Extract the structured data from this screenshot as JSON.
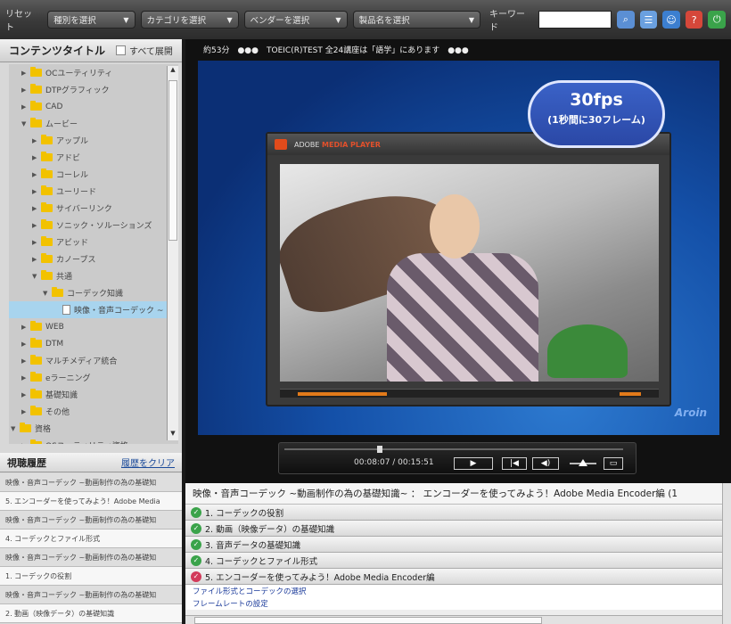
{
  "toolbar": {
    "reset": "リセット",
    "selects": [
      {
        "label": "種別を選択",
        "w": 100
      },
      {
        "label": "カテゴリを選択",
        "w": 118
      },
      {
        "label": "ベンダーを選択",
        "w": 118
      },
      {
        "label": "製品名を選択",
        "w": 148
      }
    ],
    "keyword_label": "キーワード",
    "keyword_value": ""
  },
  "left": {
    "title": "コンテンツタイトル",
    "expand_all": "すべて展開",
    "tree": [
      {
        "label": "OCユーティリティ",
        "indent": 0,
        "type": "folder",
        "tri": "▶"
      },
      {
        "label": "DTPグラフィック",
        "indent": 0,
        "type": "folder",
        "tri": "▶"
      },
      {
        "label": "CAD",
        "indent": 0,
        "type": "folder",
        "tri": "▶"
      },
      {
        "label": "ムービー",
        "indent": 0,
        "type": "folder",
        "tri": "▼"
      },
      {
        "label": "アップル",
        "indent": 1,
        "type": "folder",
        "tri": "▶"
      },
      {
        "label": "アドビ",
        "indent": 1,
        "type": "folder",
        "tri": "▶"
      },
      {
        "label": "コーレル",
        "indent": 1,
        "type": "folder",
        "tri": "▶"
      },
      {
        "label": "ユーリード",
        "indent": 1,
        "type": "folder",
        "tri": "▶"
      },
      {
        "label": "サイバーリンク",
        "indent": 1,
        "type": "folder",
        "tri": "▶"
      },
      {
        "label": "ソニック・ソルーションズ",
        "indent": 1,
        "type": "folder",
        "tri": "▶"
      },
      {
        "label": "アビッド",
        "indent": 1,
        "type": "folder",
        "tri": "▶"
      },
      {
        "label": "カノープス",
        "indent": 1,
        "type": "folder",
        "tri": "▶"
      },
      {
        "label": "共通",
        "indent": 1,
        "type": "folder",
        "tri": "▼"
      },
      {
        "label": "コーデック知識",
        "indent": 2,
        "type": "folder",
        "tri": "▼"
      },
      {
        "label": "映像・音声コーデック ~",
        "indent": 3,
        "type": "doc",
        "tri": "",
        "selected": true
      },
      {
        "label": "WEB",
        "indent": 0,
        "type": "folder",
        "tri": "▶"
      },
      {
        "label": "DTM",
        "indent": 0,
        "type": "folder",
        "tri": "▶"
      },
      {
        "label": "マルチメディア統合",
        "indent": 0,
        "type": "folder",
        "tri": "▶"
      },
      {
        "label": "eラーニング",
        "indent": 0,
        "type": "folder",
        "tri": "▶"
      },
      {
        "label": "基礎知識",
        "indent": 0,
        "type": "folder",
        "tri": "▶"
      },
      {
        "label": "その他",
        "indent": 0,
        "type": "folder",
        "tri": "▶"
      },
      {
        "label": "資格",
        "indent": -1,
        "type": "folder",
        "tri": "▼"
      },
      {
        "label": "OSユーティリティ資格",
        "indent": 0,
        "type": "folder",
        "tri": "▶"
      }
    ],
    "history_title": "視聴履歴",
    "history_clear": "履歴をクリア",
    "history": [
      "映像・音声コーデック ~動画制作の為の基礎知",
      "5. エンコーダーを使ってみよう！Adobe Media",
      "映像・音声コーデック ~動画制作の為の基礎知",
      "4. コーデックとファイル形式",
      "映像・音声コーデック ~動画制作の為の基礎知",
      "1. コーデックの役割",
      "映像・音声コーデック ~動画制作の為の基礎知",
      "2. 動画（映像データ）の基礎知識"
    ]
  },
  "main": {
    "marquee": "約53分　●●●　TOEIC(R)TEST 全24講座は「語学」にあります　●●●",
    "fps_big": "30fps",
    "fps_small": "(1秒間に30フレーム)",
    "player_brand_a": "ADOBE",
    "player_brand_b": "MEDIA PLAYER",
    "watermark": "Aroin",
    "time": "00:08:07  /  00:15:51",
    "progress": 0.51
  },
  "chapters": {
    "title": "映像・音声コーデック ~動画制作の為の基礎知識~ ： エンコーダーを使ってみよう！Adobe Media Encoder編 (1",
    "items": [
      {
        "label": "1. コーデックの役割",
        "state": "done"
      },
      {
        "label": "2. 動画（映像データ）の基礎知識",
        "state": "done"
      },
      {
        "label": "3. 音声データの基礎知識",
        "state": "done"
      },
      {
        "label": "4. コーデックとファイル形式",
        "state": "done"
      },
      {
        "label": "5. エンコーダーを使ってみよう！Adobe Media Encoder編",
        "state": "current"
      }
    ],
    "subitems": [
      "ファイル形式とコーデックの選択",
      "フレームレートの設定"
    ],
    "colors": {
      "done": "#3aa34a",
      "current": "#d23a5a"
    }
  }
}
